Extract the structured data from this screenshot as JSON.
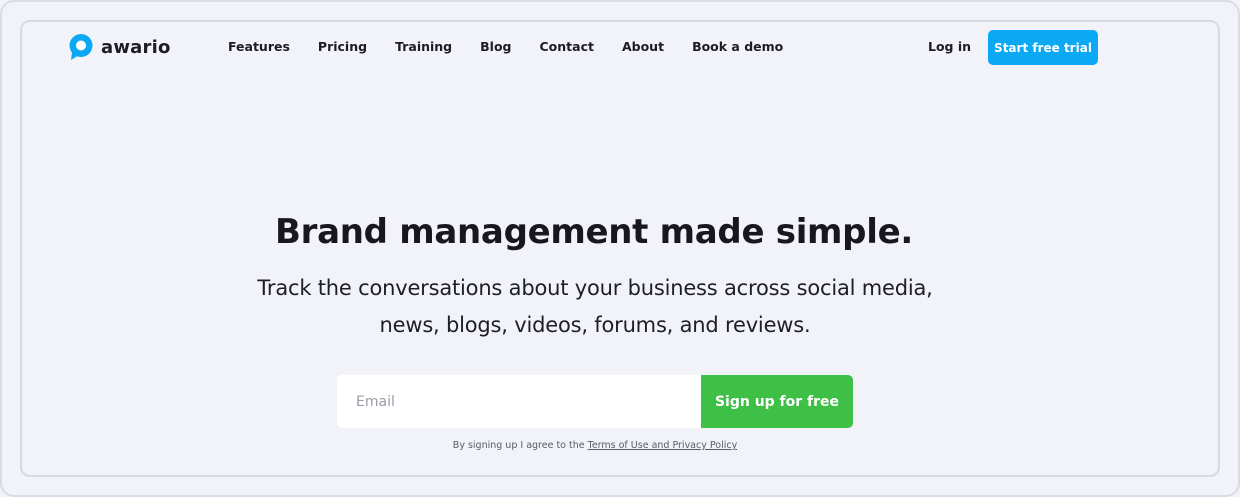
{
  "brand": {
    "name": "awario",
    "logo_icon": "awario-logo-icon",
    "accent_color": "#0ba8f4"
  },
  "nav": {
    "links": [
      "Features",
      "Pricing",
      "Training",
      "Blog",
      "Contact",
      "About",
      "Book a demo"
    ],
    "login_label": "Log in",
    "trial_label": "Start free trial"
  },
  "hero": {
    "headline": "Brand management made simple.",
    "subline_1": "Track the conversations about your business across social media,",
    "subline_2": "news, blogs, videos, forums, and reviews."
  },
  "signup": {
    "email_placeholder": "Email",
    "email_value": "",
    "button_label": "Sign up for free",
    "button_color": "#3ebf46",
    "disclaimer_prefix": "By signing up I agree to the ",
    "disclaimer_link": "Terms of Use and Privacy Policy"
  }
}
